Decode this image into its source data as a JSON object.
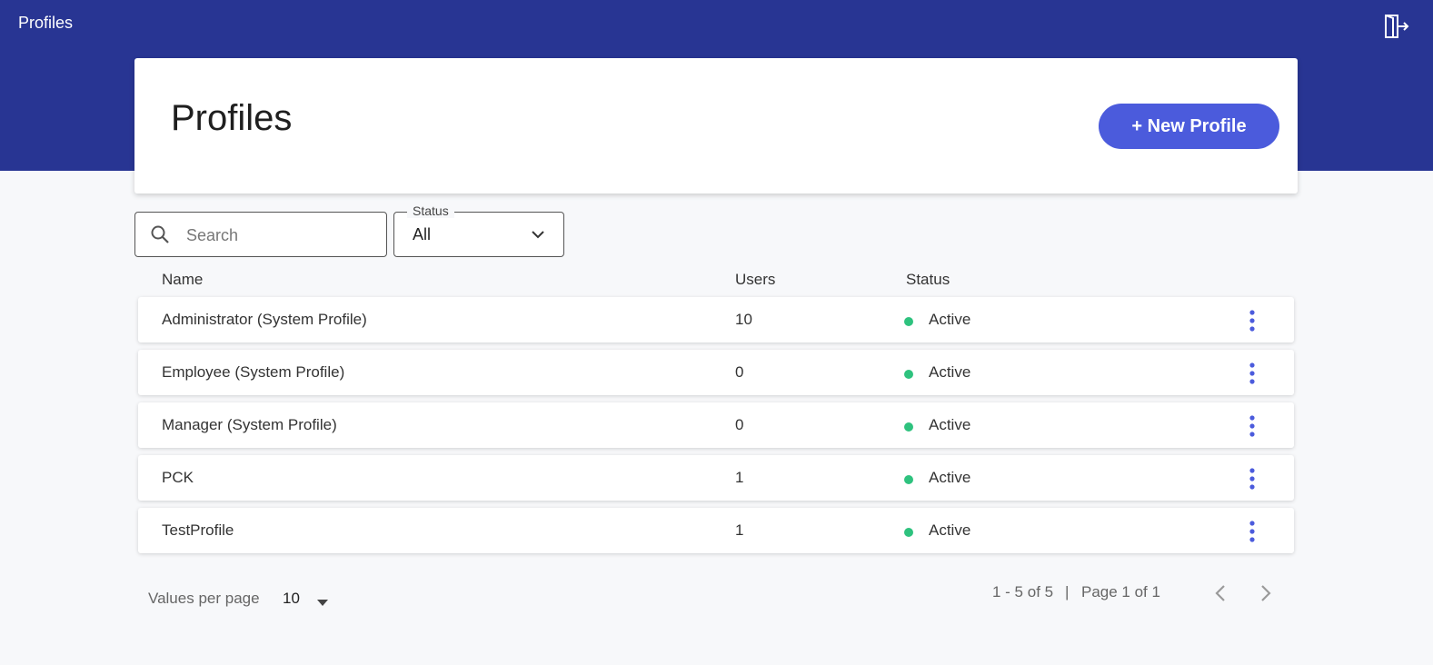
{
  "topbar": {
    "title": "Profiles",
    "logout_icon": "logout-icon"
  },
  "header": {
    "title": "Profiles",
    "new_button_label": "+ New Profile"
  },
  "filters": {
    "search_placeholder": "Search",
    "search_value": "",
    "status_label": "Status",
    "status_value": "All"
  },
  "table": {
    "columns": {
      "name": "Name",
      "users": "Users",
      "status": "Status"
    },
    "rows": [
      {
        "name": "Administrator (System Profile)",
        "users": "10",
        "status": "Active"
      },
      {
        "name": "Employee (System Profile)",
        "users": "0",
        "status": "Active"
      },
      {
        "name": "Manager (System Profile)",
        "users": "0",
        "status": "Active"
      },
      {
        "name": "PCK",
        "users": "1",
        "status": "Active"
      },
      {
        "name": "TestProfile",
        "users": "1",
        "status": "Active"
      }
    ]
  },
  "pagination": {
    "values_per_page_label": "Values per page",
    "values_per_page": "10",
    "range": "1 - 5 of 5",
    "separator": "|",
    "page_info": "Page 1 of 1"
  },
  "colors": {
    "topbar": "#283593",
    "accent": "#4b5bdc",
    "active_status": "#2ec27e"
  }
}
